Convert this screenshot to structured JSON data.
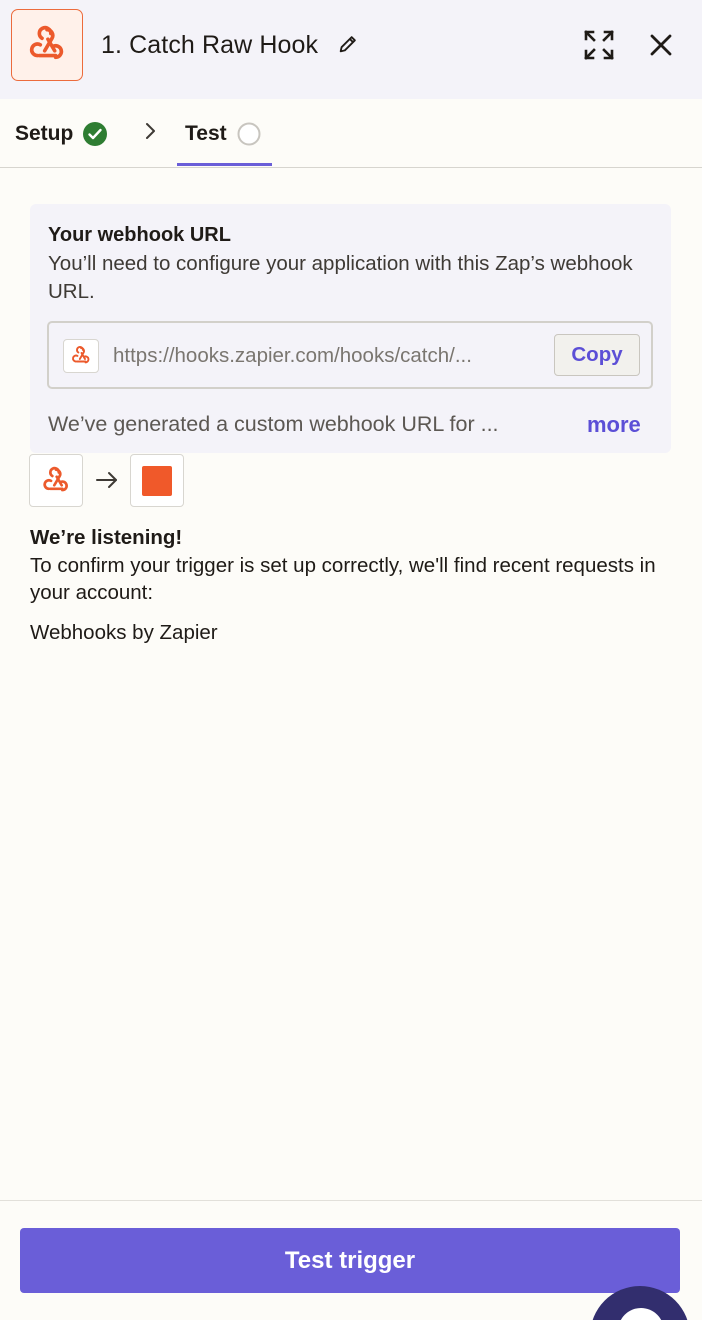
{
  "header": {
    "step_number": "1.",
    "step_title": "Catch Raw Hook",
    "icons": {
      "app": "webhook-icon",
      "edit": "pencil-icon",
      "expand": "expand-icon",
      "close": "close-icon"
    }
  },
  "tabs": [
    {
      "label": "Setup",
      "status": "complete",
      "icon": "check-circle-icon"
    },
    {
      "label": "Test",
      "status": "pending",
      "icon": "empty-circle-icon",
      "active": true
    }
  ],
  "webhook_card": {
    "title": "Your webhook URL",
    "description": "You’ll need to configure your application with this Zap’s webhook URL.",
    "url": "https://hooks.zapier.com/hooks/catch/...",
    "copy_label": "Copy",
    "note": "We’ve generated a custom webhook URL for ...",
    "more_label": "more"
  },
  "listening": {
    "title": "We’re listening!",
    "description": "To confirm your trigger is set up correctly, we'll find recent requests in your account:",
    "app_name": "Webhooks by Zapier"
  },
  "footer": {
    "button_label": "Test trigger"
  },
  "colors": {
    "accent": "#6a5ed8",
    "brand_orange": "#f0592a",
    "success": "#2e7d32",
    "header_bg": "#f4f3f9"
  }
}
